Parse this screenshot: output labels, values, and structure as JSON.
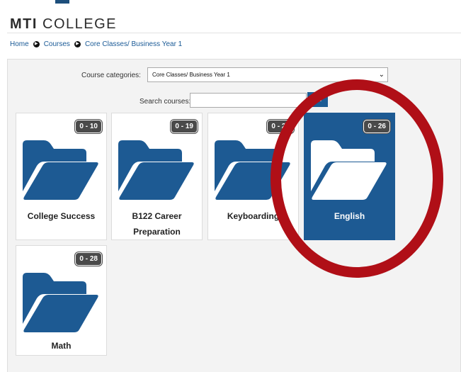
{
  "header": {
    "logo_bold": "MTI",
    "logo_rest": " COLLEGE"
  },
  "breadcrumb": {
    "items": [
      "Home",
      "Courses",
      "Core Classes/ Business Year 1"
    ],
    "separator_icon": "circle-arrow-right-icon"
  },
  "filters": {
    "category_label": "Course categories:",
    "category_value": "Core Classes/ Business Year 1",
    "search_label": "Search courses:",
    "search_value": "",
    "go_label": "Go"
  },
  "courses": [
    {
      "title": "College Success",
      "badge": "0 - 10",
      "icon": "folder-open-icon",
      "active": false
    },
    {
      "title": "B122 Career Preparation",
      "badge": "0 - 19",
      "icon": "folder-open-icon",
      "active": false
    },
    {
      "title": "Keyboarding",
      "badge": "0 - 22",
      "icon": "folder-open-icon",
      "active": false
    },
    {
      "title": "English",
      "badge": "0 - 26",
      "icon": "folder-open-icon",
      "active": true
    },
    {
      "title": "Math",
      "badge": "0 - 28",
      "icon": "folder-open-icon",
      "active": false
    }
  ],
  "annotation": {
    "shape": "ellipse",
    "color": "#b00f17",
    "target": "English"
  },
  "colors": {
    "brand": "#1d5a93",
    "badge": "#4a4a4a",
    "highlight": "#b00f17"
  }
}
